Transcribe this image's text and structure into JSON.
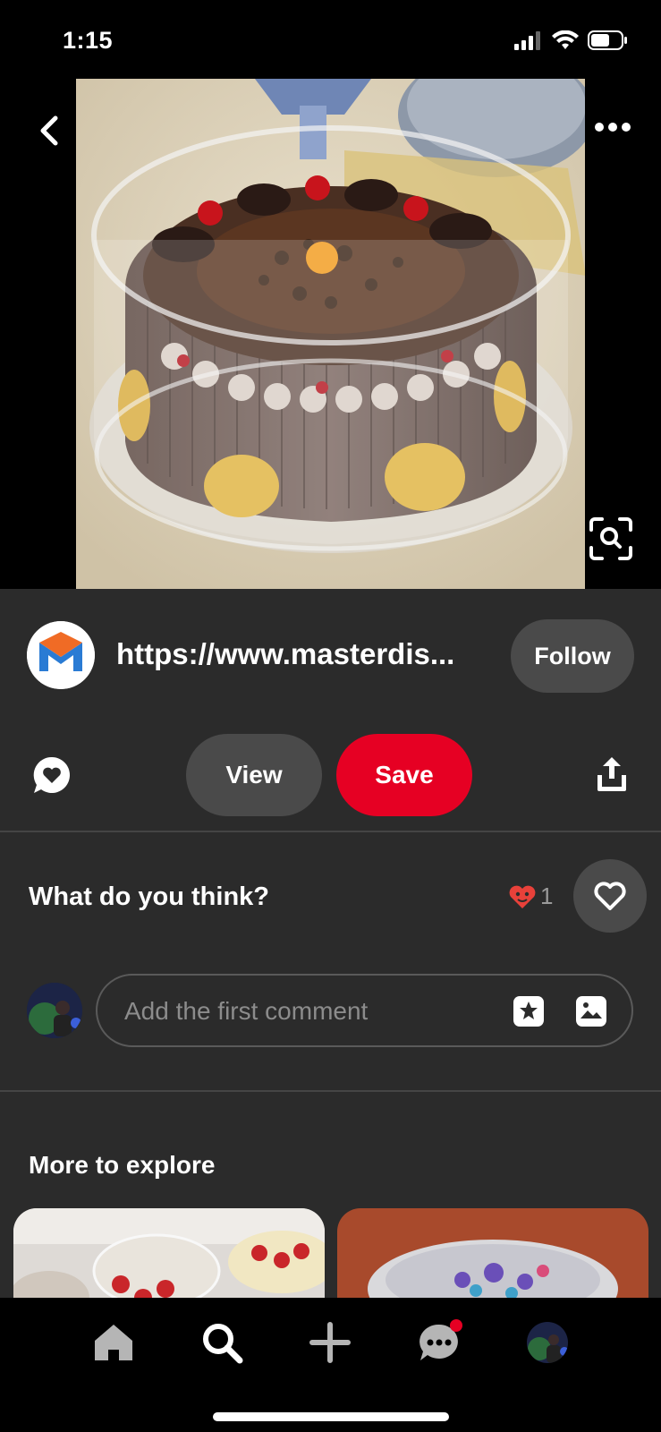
{
  "status_bar": {
    "time": "1:15"
  },
  "pin": {
    "image_icon": "cake-photo",
    "back_icon": "back-chevron-icon",
    "more_icon": "more-dots-icon",
    "lens_icon": "visual-search-icon"
  },
  "creator": {
    "url": "https://www.masterdis...",
    "follow_label": "Follow"
  },
  "actions": {
    "view_label": "View",
    "save_label": "Save"
  },
  "feedback": {
    "prompt": "What do you think?",
    "reaction_count": "1"
  },
  "comment": {
    "placeholder": "Add the first comment"
  },
  "explore": {
    "title": "More to explore"
  },
  "tab_bar": {
    "items": [
      "home-icon",
      "search-icon",
      "create-icon",
      "messages-icon",
      "profile-avatar"
    ]
  },
  "colors": {
    "accent": "#e60023",
    "panel": "#2b2b2b",
    "pill": "#4a4a4a"
  }
}
